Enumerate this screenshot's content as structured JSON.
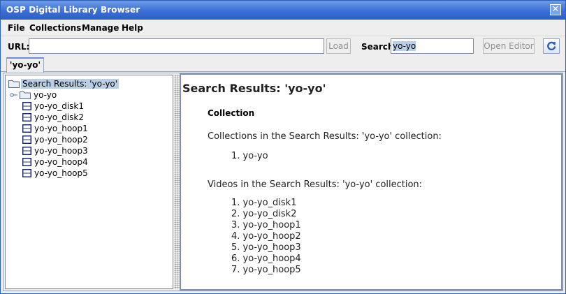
{
  "window": {
    "title": "OSP Digital Library Browser"
  },
  "menu": [
    "File",
    "Collections",
    "Manage",
    "Help"
  ],
  "toolbar": {
    "url_label": "URL:",
    "url_value": "",
    "load_label": "Load",
    "search_label": "Search",
    "search_value": "yo-yo",
    "open_editor_label": "Open Editor"
  },
  "tabs": [
    {
      "label": "'yo-yo'"
    }
  ],
  "tree": {
    "root": "Search Results: 'yo-yo'",
    "folder": "yo-yo",
    "videos": [
      "yo-yo_disk1",
      "yo-yo_disk2",
      "yo-yo_hoop1",
      "yo-yo_hoop2",
      "yo-yo_hoop3",
      "yo-yo_hoop4",
      "yo-yo_hoop5"
    ]
  },
  "doc": {
    "title": "Search Results: 'yo-yo'",
    "subtitle": "Collection",
    "collections_intro": "Collections in the Search Results: 'yo-yo' collection:",
    "collections": [
      "1. yo-yo"
    ],
    "videos_intro": "Videos in the Search Results: 'yo-yo' collection:",
    "videos": [
      "1. yo-yo_disk1",
      "2. yo-yo_disk2",
      "3. yo-yo_hoop1",
      "4. yo-yo_hoop2",
      "5. yo-yo_hoop3",
      "6. yo-yo_hoop4",
      "7. yo-yo_hoop5"
    ]
  },
  "colors": {
    "titlebar": "#3c70d6",
    "selection": "#b8cfe5"
  }
}
